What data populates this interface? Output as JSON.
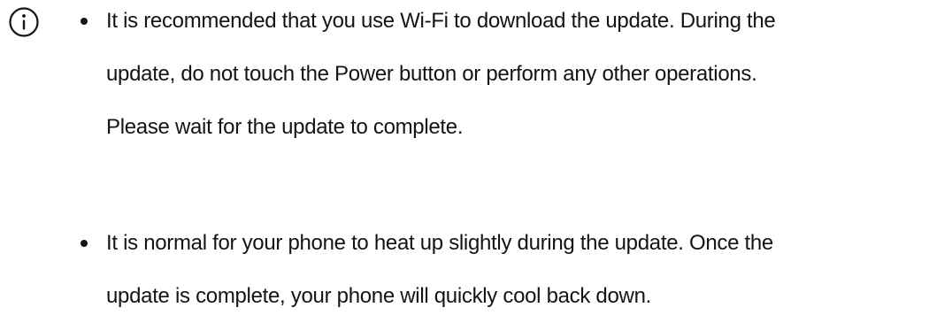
{
  "notice": {
    "icon": "info-circle-icon",
    "bullets": [
      {
        "text": "It is recommended that you use Wi-Fi to download the update. During the\nupdate, do not touch the Power button or perform any other operations.\nPlease wait for the update to complete."
      },
      {
        "text": "It is normal for your phone to heat up slightly during the update. Once the\nupdate is complete, your phone will quickly cool back down."
      }
    ]
  },
  "colors": {
    "text": "#141414",
    "background": "#ffffff"
  }
}
